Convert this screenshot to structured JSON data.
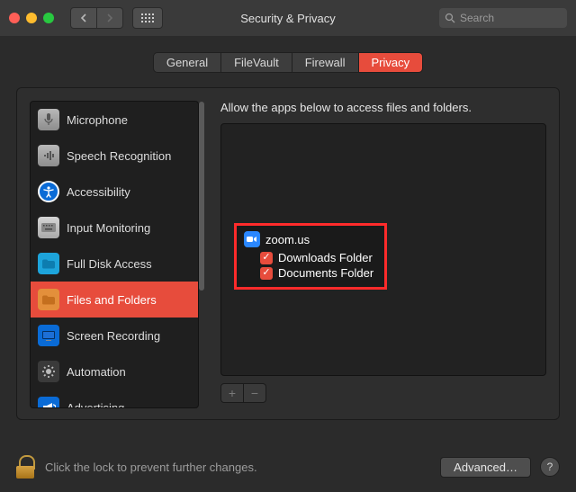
{
  "window": {
    "title": "Security & Privacy",
    "search_placeholder": "Search"
  },
  "tabs": [
    {
      "label": "General",
      "active": false
    },
    {
      "label": "FileVault",
      "active": false
    },
    {
      "label": "Firewall",
      "active": false
    },
    {
      "label": "Privacy",
      "active": true
    }
  ],
  "sidebar": {
    "items": [
      {
        "label": "Microphone",
        "icon": "microphone-icon",
        "selected": false
      },
      {
        "label": "Speech Recognition",
        "icon": "speech-icon",
        "selected": false
      },
      {
        "label": "Accessibility",
        "icon": "accessibility-icon",
        "selected": false
      },
      {
        "label": "Input Monitoring",
        "icon": "keyboard-icon",
        "selected": false
      },
      {
        "label": "Full Disk Access",
        "icon": "disk-icon",
        "selected": false
      },
      {
        "label": "Files and Folders",
        "icon": "folder-icon",
        "selected": true
      },
      {
        "label": "Screen Recording",
        "icon": "screen-icon",
        "selected": false
      },
      {
        "label": "Automation",
        "icon": "gear-icon",
        "selected": false
      },
      {
        "label": "Advertising",
        "icon": "megaphone-icon",
        "selected": false
      }
    ]
  },
  "right_pane": {
    "heading": "Allow the apps below to access files and folders.",
    "app": {
      "name": "zoom.us",
      "icon": "zoom-icon",
      "permissions": [
        {
          "label": "Downloads Folder",
          "checked": true
        },
        {
          "label": "Documents Folder",
          "checked": true
        }
      ]
    }
  },
  "footer": {
    "lock_text": "Click the lock to prevent further changes.",
    "advanced_label": "Advanced…",
    "help_label": "?"
  },
  "colors": {
    "accent": "#e74c3c",
    "highlight_border": "#ff2b2b",
    "window_bg": "#2b2b2b"
  }
}
